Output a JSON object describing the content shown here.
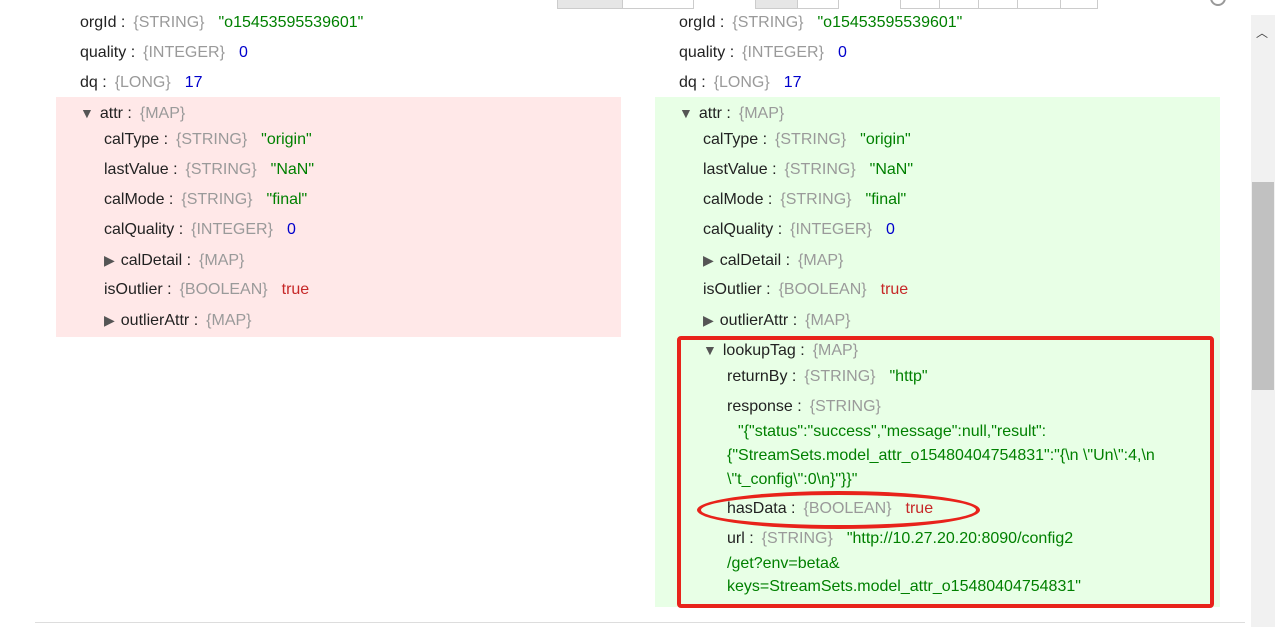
{
  "left": {
    "orgId": {
      "key": "orgId",
      "type": "{STRING}",
      "value": "\"o15453595539601\""
    },
    "quality": {
      "key": "quality",
      "type": "{INTEGER}",
      "value": "0"
    },
    "dq": {
      "key": "dq",
      "type": "{LONG}",
      "value": "17"
    },
    "attr": {
      "key": "attr",
      "type": "{MAP}",
      "toggle": "▼",
      "calType": {
        "key": "calType",
        "type": "{STRING}",
        "value": "\"origin\""
      },
      "lastValue": {
        "key": "lastValue",
        "type": "{STRING}",
        "value": "\"NaN\""
      },
      "calMode": {
        "key": "calMode",
        "type": "{STRING}",
        "value": "\"final\""
      },
      "calQuality": {
        "key": "calQuality",
        "type": "{INTEGER}",
        "value": "0"
      },
      "calDetail": {
        "key": "calDetail",
        "type": "{MAP}",
        "toggle": "▶"
      },
      "isOutlier": {
        "key": "isOutlier",
        "type": "{BOOLEAN}",
        "value": "true"
      },
      "outlierAttr": {
        "key": "outlierAttr",
        "type": "{MAP}",
        "toggle": "▶"
      }
    }
  },
  "right": {
    "orgId": {
      "key": "orgId",
      "type": "{STRING}",
      "value": "\"o15453595539601\""
    },
    "quality": {
      "key": "quality",
      "type": "{INTEGER}",
      "value": "0"
    },
    "dq": {
      "key": "dq",
      "type": "{LONG}",
      "value": "17"
    },
    "attr": {
      "key": "attr",
      "type": "{MAP}",
      "toggle": "▼",
      "calType": {
        "key": "calType",
        "type": "{STRING}",
        "value": "\"origin\""
      },
      "lastValue": {
        "key": "lastValue",
        "type": "{STRING}",
        "value": "\"NaN\""
      },
      "calMode": {
        "key": "calMode",
        "type": "{STRING}",
        "value": "\"final\""
      },
      "calQuality": {
        "key": "calQuality",
        "type": "{INTEGER}",
        "value": "0"
      },
      "calDetail": {
        "key": "calDetail",
        "type": "{MAP}",
        "toggle": "▶"
      },
      "isOutlier": {
        "key": "isOutlier",
        "type": "{BOOLEAN}",
        "value": "true"
      },
      "outlierAttr": {
        "key": "outlierAttr",
        "type": "{MAP}",
        "toggle": "▶"
      },
      "lookupTag": {
        "key": "lookupTag",
        "type": "{MAP}",
        "toggle": "▼",
        "returnBy": {
          "key": "returnBy",
          "type": "{STRING}",
          "value": "\"http\""
        },
        "response": {
          "key": "response",
          "type": "{STRING}",
          "value_lines": [
            "\"{\"status\":\"success\",\"message\":null,\"result\":",
            "{\"StreamSets.model_attr_o15480404754831\":\"{\\n \\\"Un\\\":4,\\n",
            "\\\"t_config\\\":0\\n}\"}}\""
          ]
        },
        "hasData": {
          "key": "hasData",
          "type": "{BOOLEAN}",
          "value": "true"
        },
        "url": {
          "key": "url",
          "type": "{STRING}",
          "value_lines": [
            "\"http://10.27.20.20:8090/config2",
            "/get?env=beta&",
            "keys=StreamSets.model_attr_o15480404754831\""
          ]
        }
      }
    }
  },
  "colors": {
    "removed_bg": "#ffe8e8",
    "added_bg": "#e8ffe6",
    "highlight": "#e8231b"
  }
}
